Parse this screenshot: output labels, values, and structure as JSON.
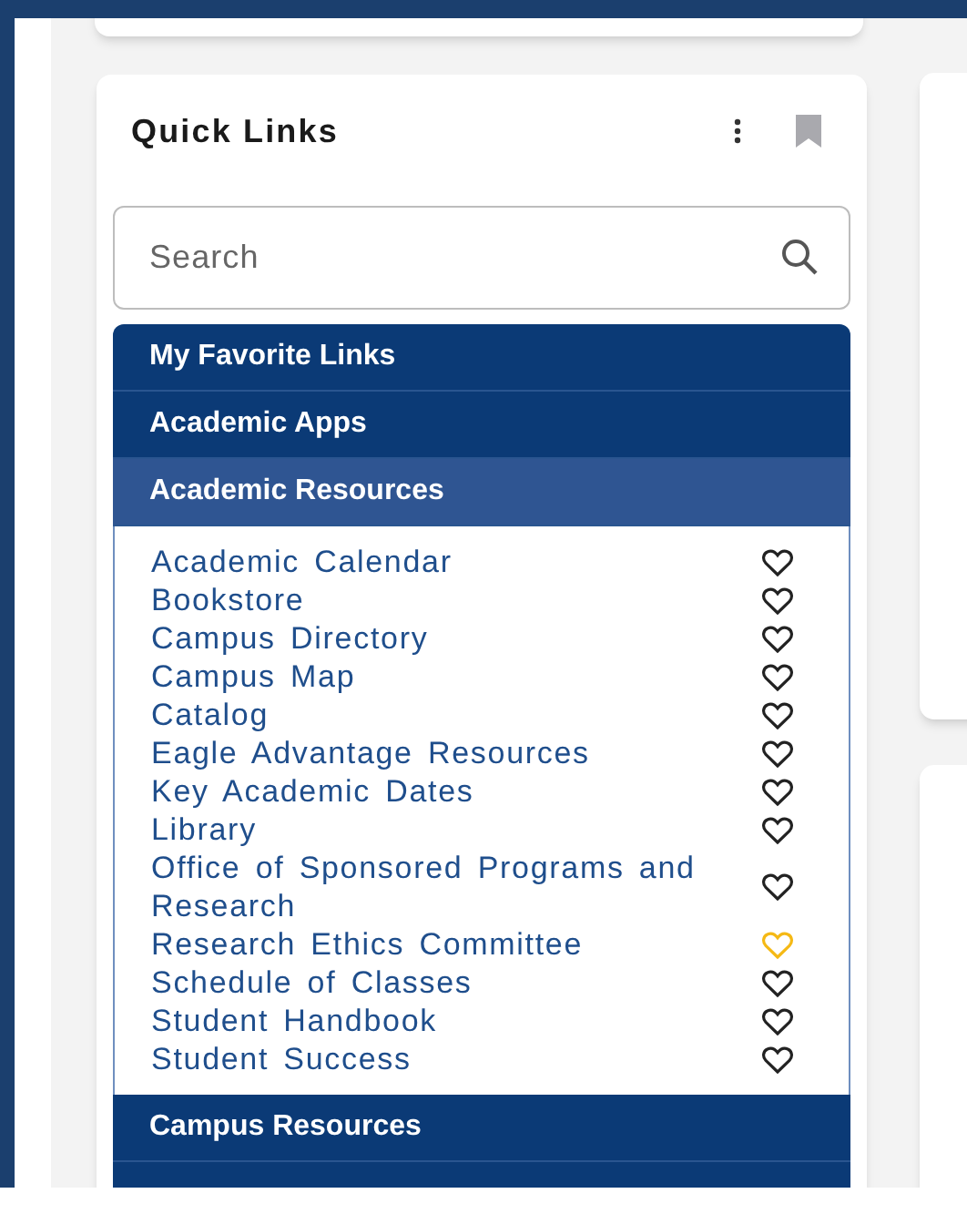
{
  "card": {
    "title": "Quick Links"
  },
  "search": {
    "placeholder": "Search"
  },
  "sections": [
    {
      "title": "My Favorite Links",
      "expanded": false
    },
    {
      "title": "Academic Apps",
      "expanded": false
    },
    {
      "title": "Academic Resources",
      "expanded": true,
      "links": [
        {
          "label": "Academic Calendar",
          "favorite": false
        },
        {
          "label": "Bookstore",
          "favorite": false
        },
        {
          "label": "Campus Directory",
          "favorite": false
        },
        {
          "label": "Campus Map",
          "favorite": false
        },
        {
          "label": "Catalog",
          "favorite": false
        },
        {
          "label": "Eagle Advantage Resources",
          "favorite": false
        },
        {
          "label": "Key Academic Dates",
          "favorite": false
        },
        {
          "label": "Library",
          "favorite": false
        },
        {
          "label": "Office of Sponsored Programs and Research",
          "favorite": false
        },
        {
          "label": "Research Ethics Committee",
          "favorite": true
        },
        {
          "label": "Schedule of Classes",
          "favorite": false
        },
        {
          "label": "Student Handbook",
          "favorite": false
        },
        {
          "label": "Student Success",
          "favorite": false
        }
      ]
    },
    {
      "title": "Campus Resources",
      "expanded": false
    },
    {
      "expanded": false
    }
  ]
}
